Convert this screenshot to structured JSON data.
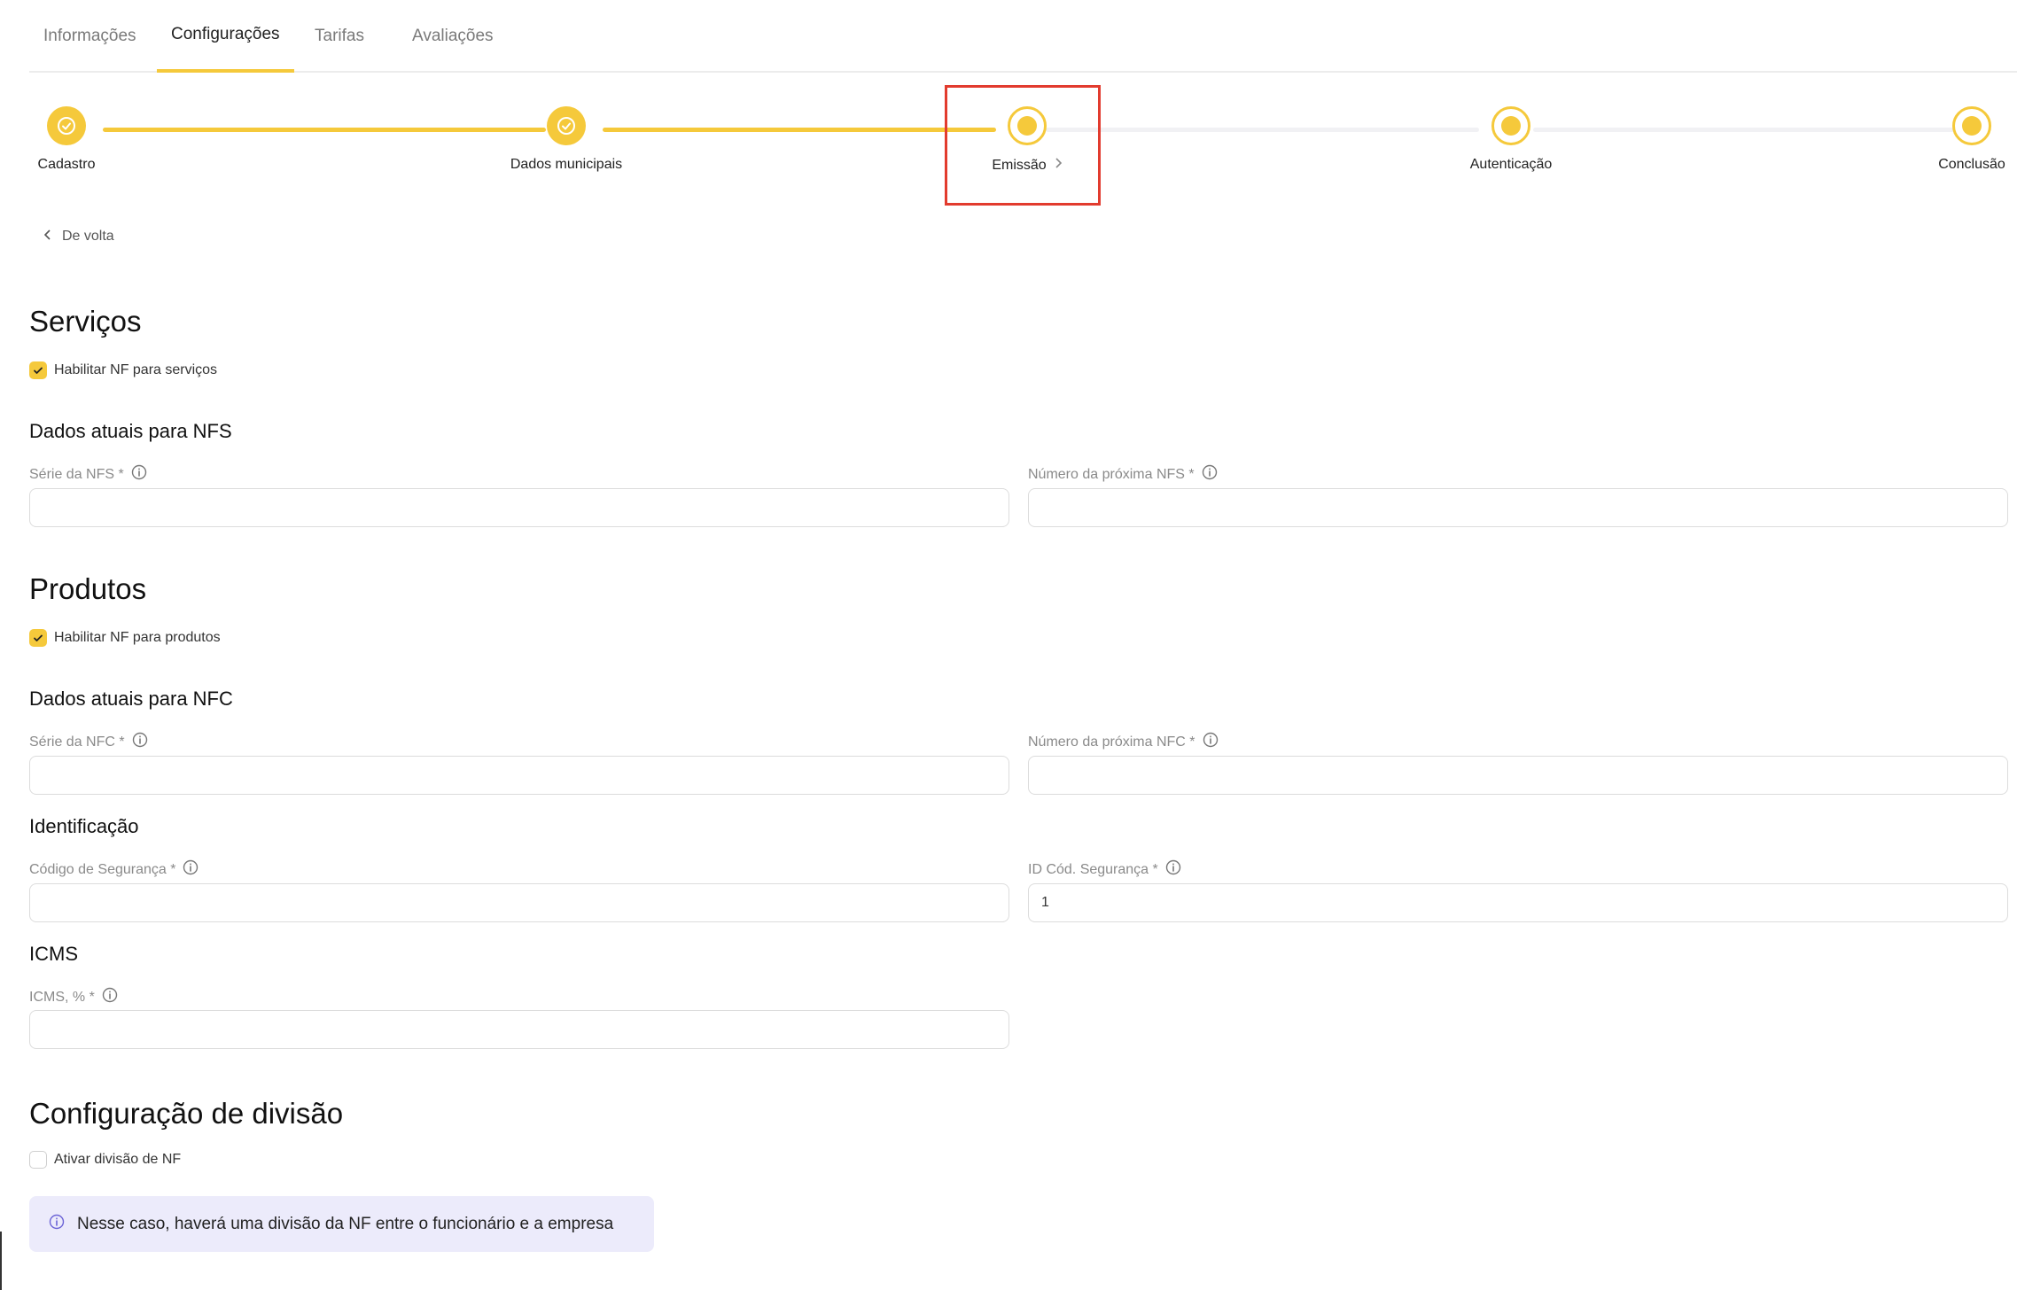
{
  "tabs": [
    {
      "label": "Informações",
      "active": false
    },
    {
      "label": "Configurações",
      "active": true
    },
    {
      "label": "Tarifas",
      "active": false
    },
    {
      "label": "Avaliações",
      "active": false
    }
  ],
  "stepper": {
    "steps": [
      {
        "label": "Cadastro",
        "state": "done"
      },
      {
        "label": "Dados municipais",
        "state": "done"
      },
      {
        "label": "Emissão",
        "state": "current"
      },
      {
        "label": "Autenticação",
        "state": "pending"
      },
      {
        "label": "Conclusão",
        "state": "pending"
      }
    ]
  },
  "back_label": "De volta",
  "services": {
    "title": "Serviços",
    "enable_label": "Habilitar NF para serviços",
    "enabled": true,
    "subtitle": "Dados atuais para NFS",
    "serie_label": "Série da NFS *",
    "serie_value": "",
    "next_label": "Número da próxima NFS *",
    "next_value": ""
  },
  "products": {
    "title": "Produtos",
    "enable_label": "Habilitar NF para produtos",
    "enabled": true,
    "subtitle": "Dados atuais para NFC",
    "serie_label": "Série da NFC *",
    "serie_value": "",
    "next_label": "Número da próxima NFC *",
    "next_value": ""
  },
  "identification": {
    "title": "Identificação",
    "code_label": "Código de Segurança *",
    "code_value": "",
    "id_label": "ID Cód. Segurança *",
    "id_value": "1"
  },
  "icms": {
    "title": "ICMS",
    "label": "ICMS, % *",
    "value": ""
  },
  "division": {
    "title": "Configuração de divisão",
    "enable_label": "Ativar divisão de NF",
    "enabled": false,
    "info": "Nesse caso, haverá uma divisão da NF entre o funcionário e a empresa"
  },
  "colors": {
    "accent": "#f5c93b",
    "highlight": "#e23b2e",
    "info_bg": "#ecebfb"
  }
}
